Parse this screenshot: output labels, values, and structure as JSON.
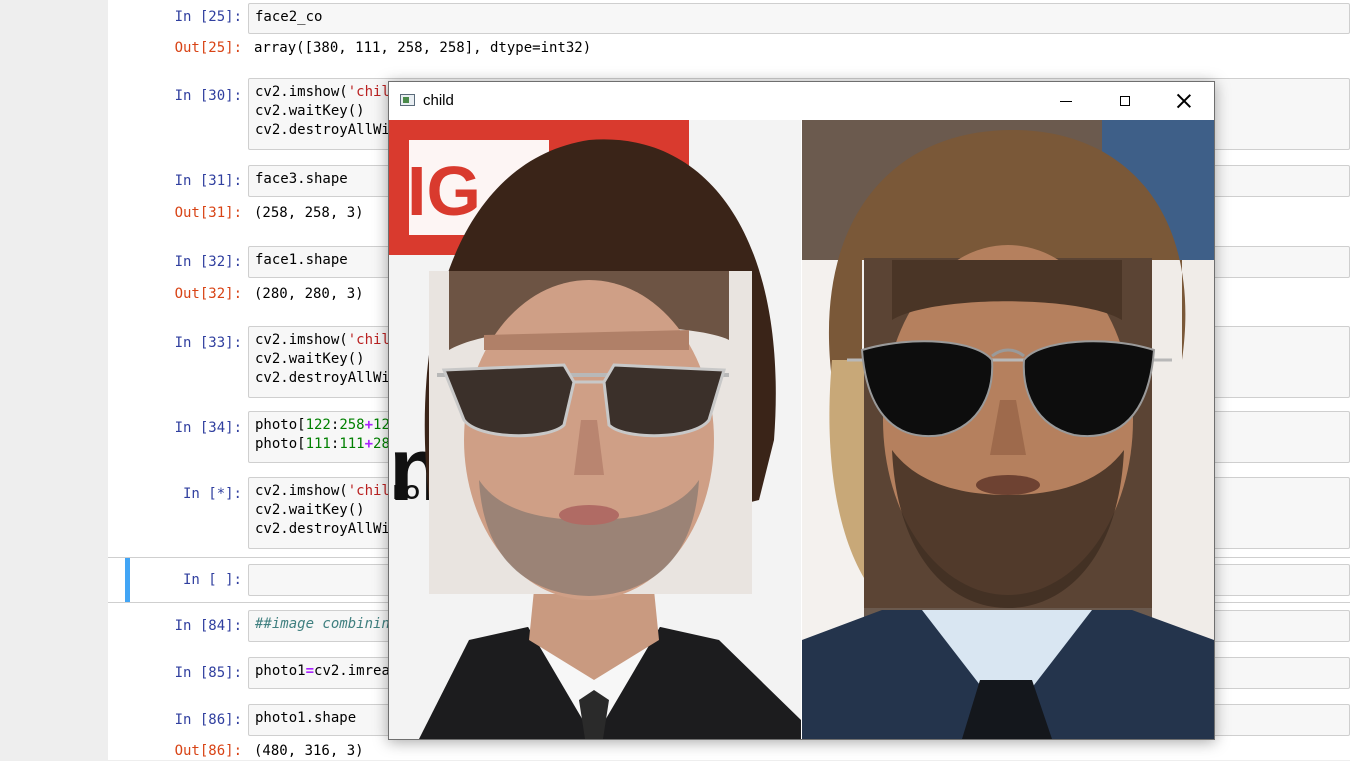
{
  "cells": [
    {
      "prompt": "In [25]:",
      "code": [
        "face2_co"
      ]
    },
    {
      "prompt": "Out[25]:",
      "output": "array([380, 111, 258, 258], dtype=int32)"
    },
    {
      "prompt": "In [30]:",
      "code": [
        "cv2.imshow('chil",
        "cv2.waitKey()",
        "cv2.destroyAllWi"
      ]
    },
    {
      "prompt": "In [31]:",
      "code": [
        "face3.shape"
      ]
    },
    {
      "prompt": "Out[31]:",
      "output": "(258, 258, 3)"
    },
    {
      "prompt": "In [32]:",
      "code": [
        "face1.shape"
      ]
    },
    {
      "prompt": "Out[32]:",
      "output": "(280, 280, 3)"
    },
    {
      "prompt": "In [33]:",
      "code": [
        "cv2.imshow('chil",
        "cv2.waitKey()",
        "cv2.destroyAllWi"
      ]
    },
    {
      "prompt": "In [34]:",
      "code": [
        "photo[122:258+12",
        "photo[111:111+28"
      ]
    },
    {
      "prompt": "In [*]:",
      "code": [
        "cv2.imshow('chil",
        "cv2.waitKey()",
        "cv2.destroyAllWi"
      ]
    },
    {
      "prompt": "In [ ]:",
      "code": [
        ""
      ]
    },
    {
      "prompt": "In [84]:",
      "code": [
        "##image combinin"
      ]
    },
    {
      "prompt": "In [85]:",
      "code": [
        "photo1=cv2.imrea"
      ]
    },
    {
      "prompt": "In [86]:",
      "code": [
        "photo1.shape"
      ]
    },
    {
      "prompt": "Out[86]:",
      "output": "(480, 316, 3)"
    }
  ],
  "window": {
    "title": "child",
    "icons": [
      "app-icon",
      "minimize-icon",
      "maximize-icon",
      "close-icon"
    ]
  },
  "canvas_text": {
    "banner_letters": "IG",
    "backdrop_letter": "n",
    "backdrop_small": "I O"
  },
  "colors": {
    "prompt_in": "#303f9f",
    "prompt_out": "#d84315",
    "selected_cell_bar": "#42a5f5",
    "code_bg": "#f7f7f7"
  }
}
